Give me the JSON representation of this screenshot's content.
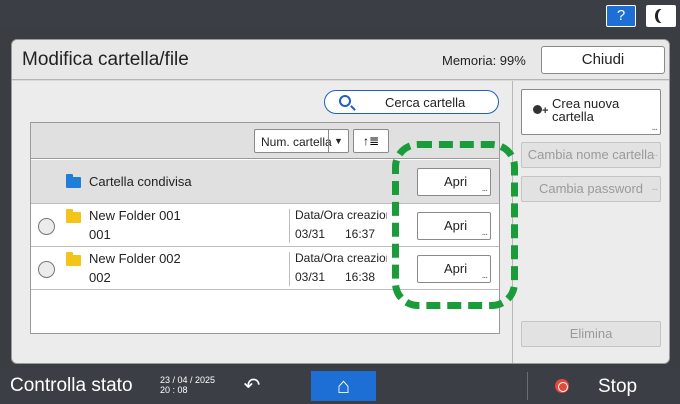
{
  "top": {
    "help_label": "?"
  },
  "header": {
    "title": "Modifica cartella/file",
    "memory": "Memoria: 99%",
    "close_label": "Chiudi"
  },
  "search": {
    "label": "Cerca cartella"
  },
  "sort": {
    "field": "Num. cartella",
    "arrow": "▼",
    "order": "↑≣"
  },
  "shared_folder": {
    "name": "Cartella condivisa",
    "open_label": "Apri"
  },
  "rows": [
    {
      "name": "New Folder 001",
      "id": "001",
      "date_label": "Data/Ora creazion",
      "date": "03/31",
      "time": "16:37",
      "open_label": "Apri"
    },
    {
      "name": "New Folder 002",
      "id": "002",
      "date_label": "Data/Ora creazion",
      "date": "03/31",
      "time": "16:38",
      "open_label": "Apri"
    }
  ],
  "actions": {
    "create_folder": "Crea nuova cartella",
    "rename": "Cambia nome cartella",
    "change_password": "Cambia password",
    "delete": "Elimina"
  },
  "ellipsis": "...",
  "status_bar": {
    "check_status": "Controlla stato",
    "date": "23 / 04 / 2025",
    "time": "20 : 08",
    "stop": "Stop"
  },
  "colors": {
    "accent": "#1d6fd6",
    "highlight": "#1a9c3a",
    "folder_yellow": "#f3c419",
    "folder_blue": "#1e7ed8",
    "stop_red": "#e24a3b"
  }
}
